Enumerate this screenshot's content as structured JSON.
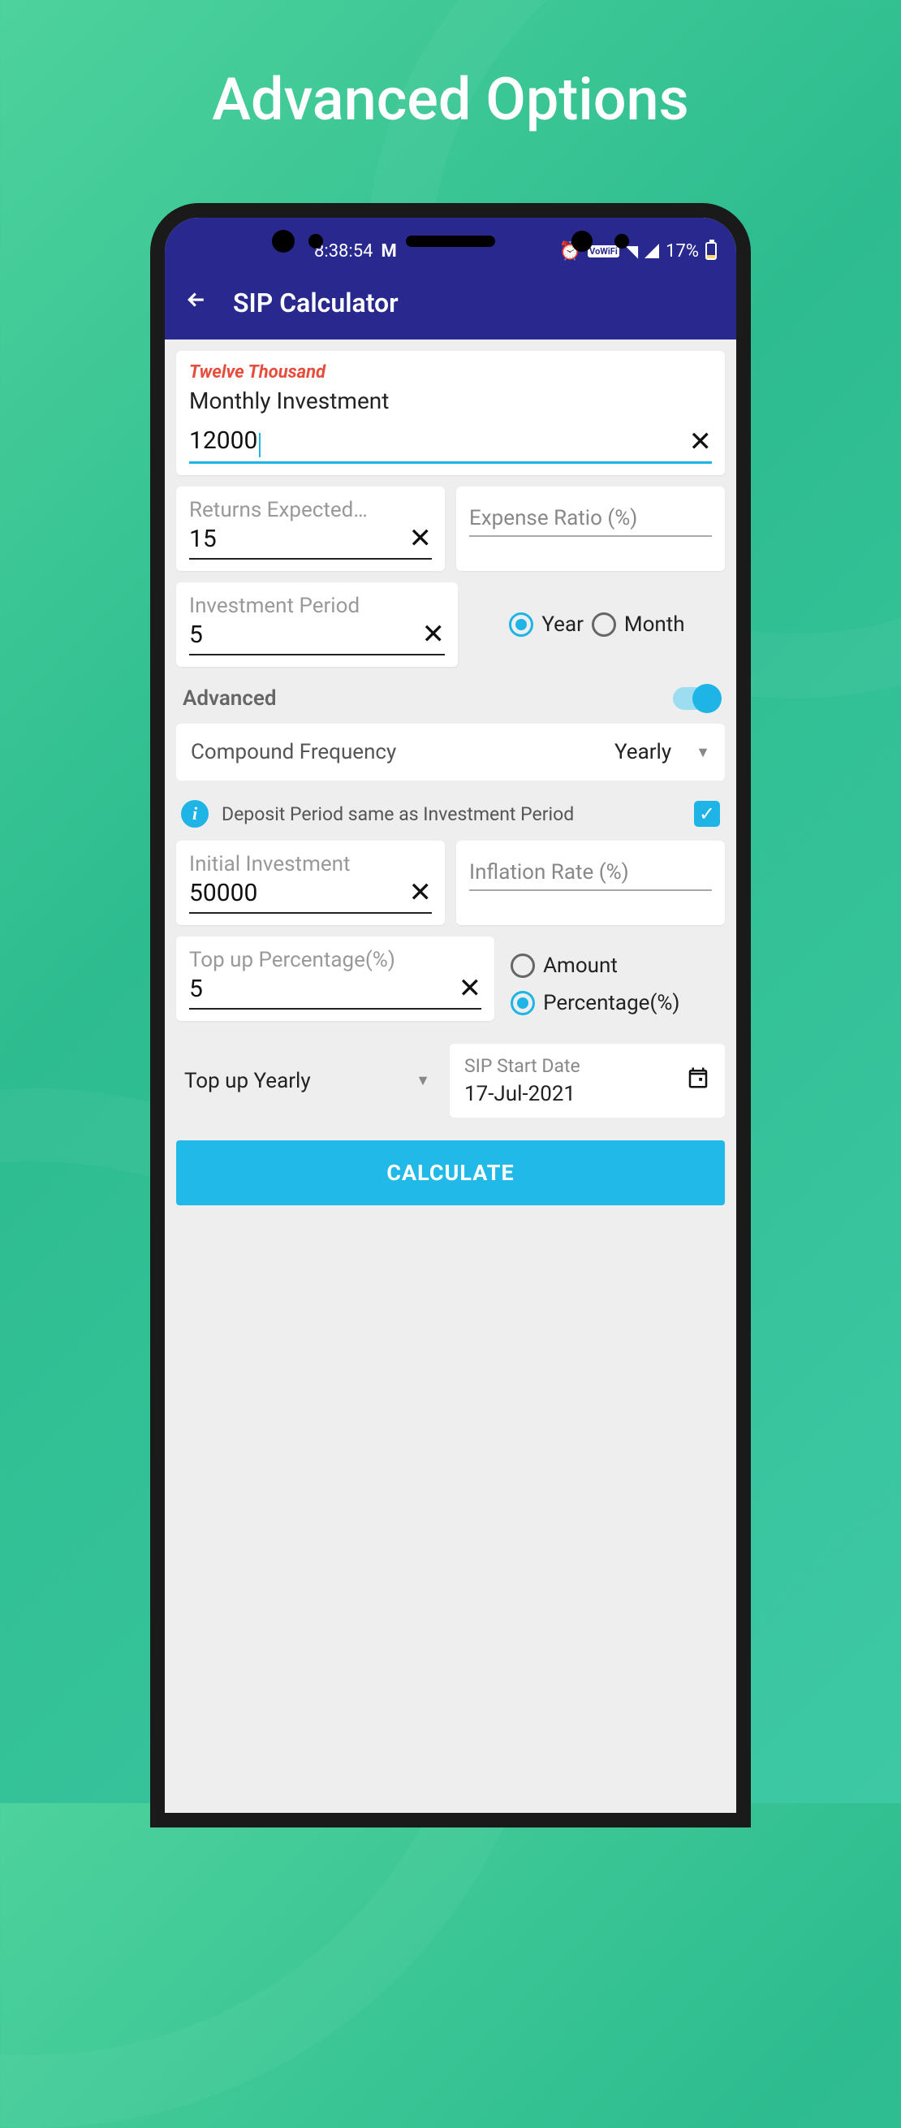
{
  "promo_title": "Advanced Options",
  "status": {
    "time": "8:38:54",
    "battery": "17%"
  },
  "app_bar": {
    "title": "SIP Calculator"
  },
  "monthly": {
    "helper": "Twelve Thousand",
    "label": "Monthly Investment",
    "value": "12000"
  },
  "returns": {
    "label": "Returns Expected…",
    "value": "15"
  },
  "expense": {
    "placeholder": "Expense Ratio (%)"
  },
  "period": {
    "label": "Investment Period",
    "value": "5"
  },
  "period_unit": {
    "year": "Year",
    "month": "Month"
  },
  "advanced": {
    "title": "Advanced"
  },
  "compound": {
    "label": "Compound Frequency",
    "value": "Yearly"
  },
  "deposit_info": "Deposit Period same as Investment Period",
  "initial": {
    "label": "Initial Investment",
    "value": "50000"
  },
  "inflation": {
    "placeholder": "Inflation Rate (%)"
  },
  "topup": {
    "label": "Top up Percentage(%)",
    "value": "5"
  },
  "topup_type": {
    "amount": "Amount",
    "percent": "Percentage(%)"
  },
  "topup_freq": {
    "value": "Top up Yearly"
  },
  "start_date": {
    "label": "SIP Start Date",
    "value": "17-Jul-2021"
  },
  "calculate": "CALCULATE"
}
